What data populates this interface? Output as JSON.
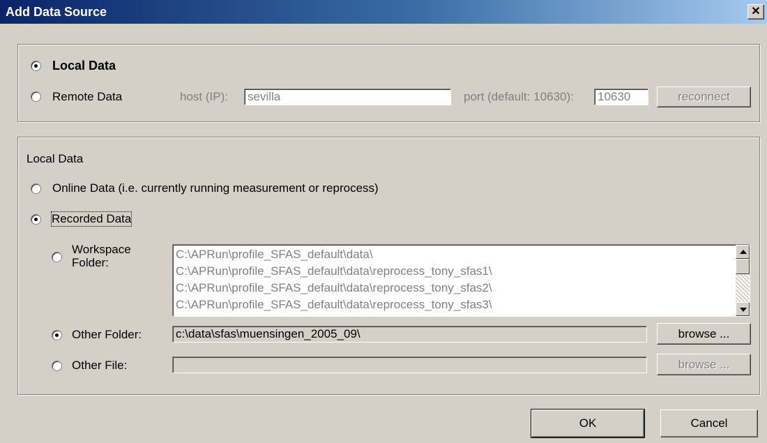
{
  "window": {
    "title": "Add Data Source",
    "close_label": "✕"
  },
  "source": {
    "local_label": "Local Data",
    "remote_label": "Remote Data",
    "host_label": "host (IP):",
    "host_value": "sevilla",
    "port_label": "port (default: 10630):",
    "port_value": "10630",
    "reconnect_label": "reconnect",
    "selected": "local"
  },
  "local": {
    "group_label": "Local Data",
    "online_label": "Online Data (i.e. currently running measurement or reprocess)",
    "recorded_label": "Recorded Data",
    "workspace_label_line1": "Workspace",
    "workspace_label_line2": "Folder:",
    "workspace_items": [
      "C:\\APRun\\profile_SFAS_default\\data\\",
      "C:\\APRun\\profile_SFAS_default\\data\\reprocess_tony_sfas1\\",
      "C:\\APRun\\profile_SFAS_default\\data\\reprocess_tony_sfas2\\",
      "C:\\APRun\\profile_SFAS_default\\data\\reprocess_tony_sfas3\\"
    ],
    "other_folder_label": "Other Folder:",
    "other_folder_value": "c:\\data\\sfas\\muensingen_2005_09\\",
    "other_folder_browse": "browse ...",
    "other_file_label": "Other File:",
    "other_file_value": "",
    "other_file_browse": "browse ...",
    "selected": "other_folder"
  },
  "buttons": {
    "ok_label": "OK",
    "cancel_label": "Cancel"
  },
  "icons": {
    "radio": "radio-button",
    "scroll_up": "scroll-up-arrow-icon",
    "scroll_down": "scroll-down-arrow-icon",
    "close": "close-icon"
  }
}
